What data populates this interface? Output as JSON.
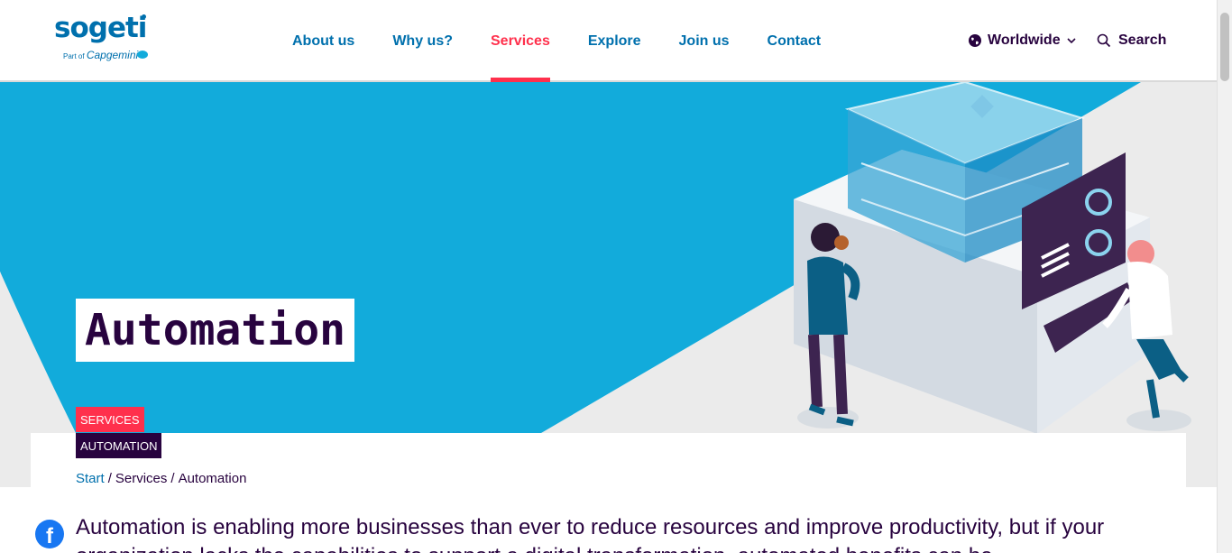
{
  "header": {
    "logo": {
      "word": "sogeti",
      "sub_prefix": "Part of",
      "sub_brand": "Capgemini"
    },
    "nav": [
      {
        "label": "About us",
        "active": false
      },
      {
        "label": "Why us?",
        "active": false
      },
      {
        "label": "Services",
        "active": true
      },
      {
        "label": "Explore",
        "active": false
      },
      {
        "label": "Join us",
        "active": false
      },
      {
        "label": "Contact",
        "active": false
      }
    ],
    "region_label": "Worldwide",
    "search_label": "Search"
  },
  "hero": {
    "title": "Automation",
    "tags": [
      "SERVICES",
      "AUTOMATION"
    ]
  },
  "breadcrumb": {
    "start": "Start",
    "sep": "/",
    "services": "Services",
    "current": "Automation"
  },
  "intro_text": "Automation is enabling more businesses than ever to reduce resources and improve productivity, but if your organization lacks the capabilities to support a digital transformation, automated benefits can be",
  "colors": {
    "brand_blue": "#0070ad",
    "accent_red": "#ff304c",
    "dark_purple": "#28033f",
    "hero_blue": "#12abdb"
  }
}
